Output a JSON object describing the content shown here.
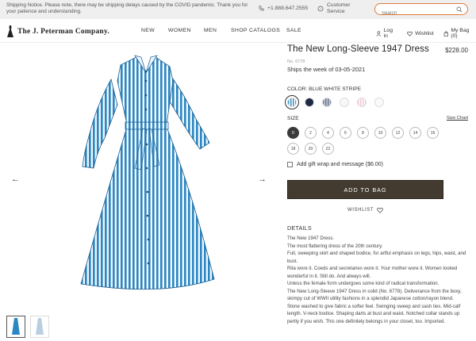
{
  "topbar": {
    "notice": "Shipping Notice. Please note, there may be shipping delays caused by the COVID pandemic. Thank you for your patience and understanding.",
    "phone": "+1.888.647.2555",
    "customer_service": "Customer Service",
    "search_placeholder": "Search"
  },
  "nav": {
    "logo": "The J. Peterman Company.",
    "menu": [
      "NEW",
      "WOMEN",
      "MEN",
      "SHOP CATALOGS",
      "SALE"
    ],
    "login": "Log in",
    "wishlist": "Wishlist",
    "bag": "My Bag (0)"
  },
  "product": {
    "title": "The New Long-Sleeve 1947 Dress",
    "price": "$228.00",
    "sku": "No. 6778",
    "ships": "Ships the week of 03-05-2021",
    "color_label": "COLOR: BLUE WHITE STRIPE",
    "swatches": [
      "#2f8fc4",
      "#1e2a44",
      "#6b7790",
      "#f7f7f7",
      "#f2c5d8",
      "#fafafa"
    ],
    "size_label": "SIZE",
    "size_chart": "Size Chart",
    "sizes": [
      "0",
      "2",
      "4",
      "6",
      "8",
      "10",
      "12",
      "14",
      "16",
      "18",
      "20",
      "22"
    ],
    "selected_size": "0",
    "gift": "Add gift wrap and message ($6.00)",
    "add_to_bag": "ADD TO BAG",
    "wishlist": "WISHLIST",
    "details_heading": "DETAILS",
    "details": [
      "The New 1947 Dress.",
      "The most flattering dress of the 20th century.",
      "Full, sweeping skirt and shaped bodice, for artful emphasis on legs, hips, waist, and bust.",
      "Rita wore it. Coeds and secretaries wore it. Your mother wore it. Women looked wonderful in it. Still do. And always will.",
      "Unless the female form undergoes some kind of radical transformation.",
      "The New Long-Sleeve 1947 Dress in solid (No. 6778). Deliverance from the boxy, skimpy cut of WWII utility fashions in a splendid Japanese cotton/rayon blend. Stone washed to give fabric a softer feel. Swinging sweep and sash ties. Mid-calf length. V-neck bodice. Shaping darts at bust and waist. Notched collar stands up pertly if you wish. This one definitely belongs in your closet, too. Imported."
    ]
  },
  "gallery": {
    "prev": "←",
    "next": "→"
  }
}
